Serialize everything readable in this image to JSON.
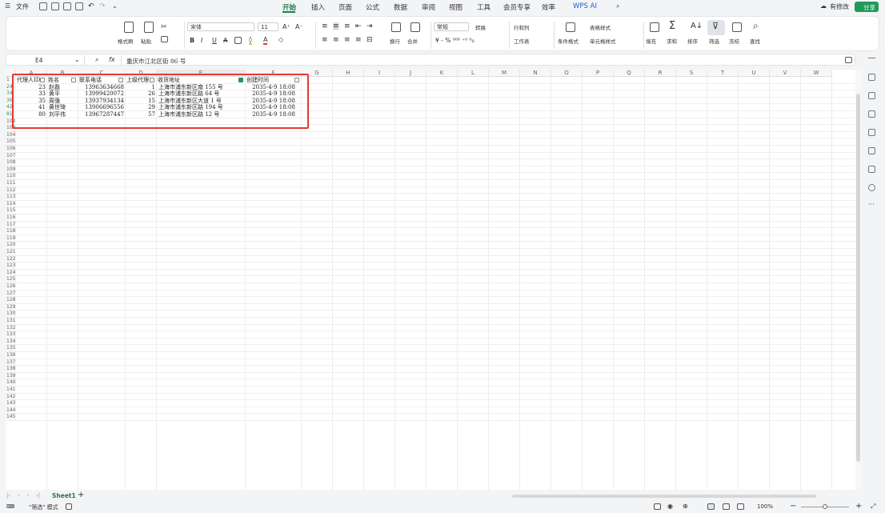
{
  "menubar": {
    "file": "文件",
    "tabs": [
      "开始",
      "插入",
      "页面",
      "公式",
      "数据",
      "审阅",
      "视图",
      "工具",
      "会员专享",
      "效率",
      "WPS AI"
    ],
    "active_tab": "开始",
    "has_changes": "有修改",
    "share": "分享"
  },
  "ribbon": {
    "format_painter": "格式刷",
    "paste": "粘贴",
    "font_name": "宋体",
    "font_size": "11",
    "wrap": "换行",
    "merge": "合并",
    "number_format": "常规",
    "convert": "转换",
    "row_col": "行和列",
    "worksheet": "工作表",
    "cond_format": "条件格式",
    "table_style": "表格样式",
    "cell_style": "单元格样式",
    "fill": "填充",
    "sum": "求和",
    "sort": "排序",
    "filter": "筛选",
    "freeze": "冻结",
    "find": "查找"
  },
  "formula": {
    "cell_ref": "E4",
    "fx": "fx",
    "content": "重庆市江北区街 86 号"
  },
  "columns": [
    "A",
    "B",
    "C",
    "D",
    "E",
    "F",
    "G",
    "H",
    "I",
    "J",
    "K",
    "L",
    "M",
    "N",
    "O",
    "P",
    "Q",
    "R",
    "S",
    "T",
    "U",
    "V",
    "W"
  ],
  "headers": {
    "a": "代理人ID",
    "b": "姓名",
    "c": "联系电话",
    "d": "上级代理",
    "e": "收货地址",
    "f": "创建时间"
  },
  "rows": [
    {
      "row": "24",
      "a": "23",
      "b": "赵磊",
      "c": "13963634668",
      "d": "1",
      "e": "上海市浦东新区南 155 号",
      "f": "2035-4-9 18:08"
    },
    {
      "row": "34",
      "a": "33",
      "b": "黄平",
      "c": "13999420072",
      "d": "26",
      "e": "上海市浦东新区路 64 号",
      "f": "2035-4-9 18:08"
    },
    {
      "row": "36",
      "a": "35",
      "b": "周强",
      "c": "13937934134",
      "d": "15",
      "e": "上海市浦东新区大道 1 号",
      "f": "2035-4-9 18:08"
    },
    {
      "row": "42",
      "a": "41",
      "b": "黄世琦",
      "c": "13906696556",
      "d": "29",
      "e": "上海市浦东新区路 194 号",
      "f": "2035-4-9 18:08"
    },
    {
      "row": "81",
      "a": "80",
      "b": "刘平伟",
      "c": "13967287447",
      "d": "57",
      "e": "上海市浦东新区路 12 号",
      "f": "2035-4-9 18:08"
    }
  ],
  "empty_rows_start": 102,
  "empty_rows_end": 145,
  "sheet_tab": "Sheet1",
  "status": {
    "mode": "\"筛选\" 模式",
    "zoom": "100%"
  },
  "colors": {
    "accent": "#1a7f4b",
    "highlight": "#e53935",
    "filter_active": "#1e9b5a"
  }
}
